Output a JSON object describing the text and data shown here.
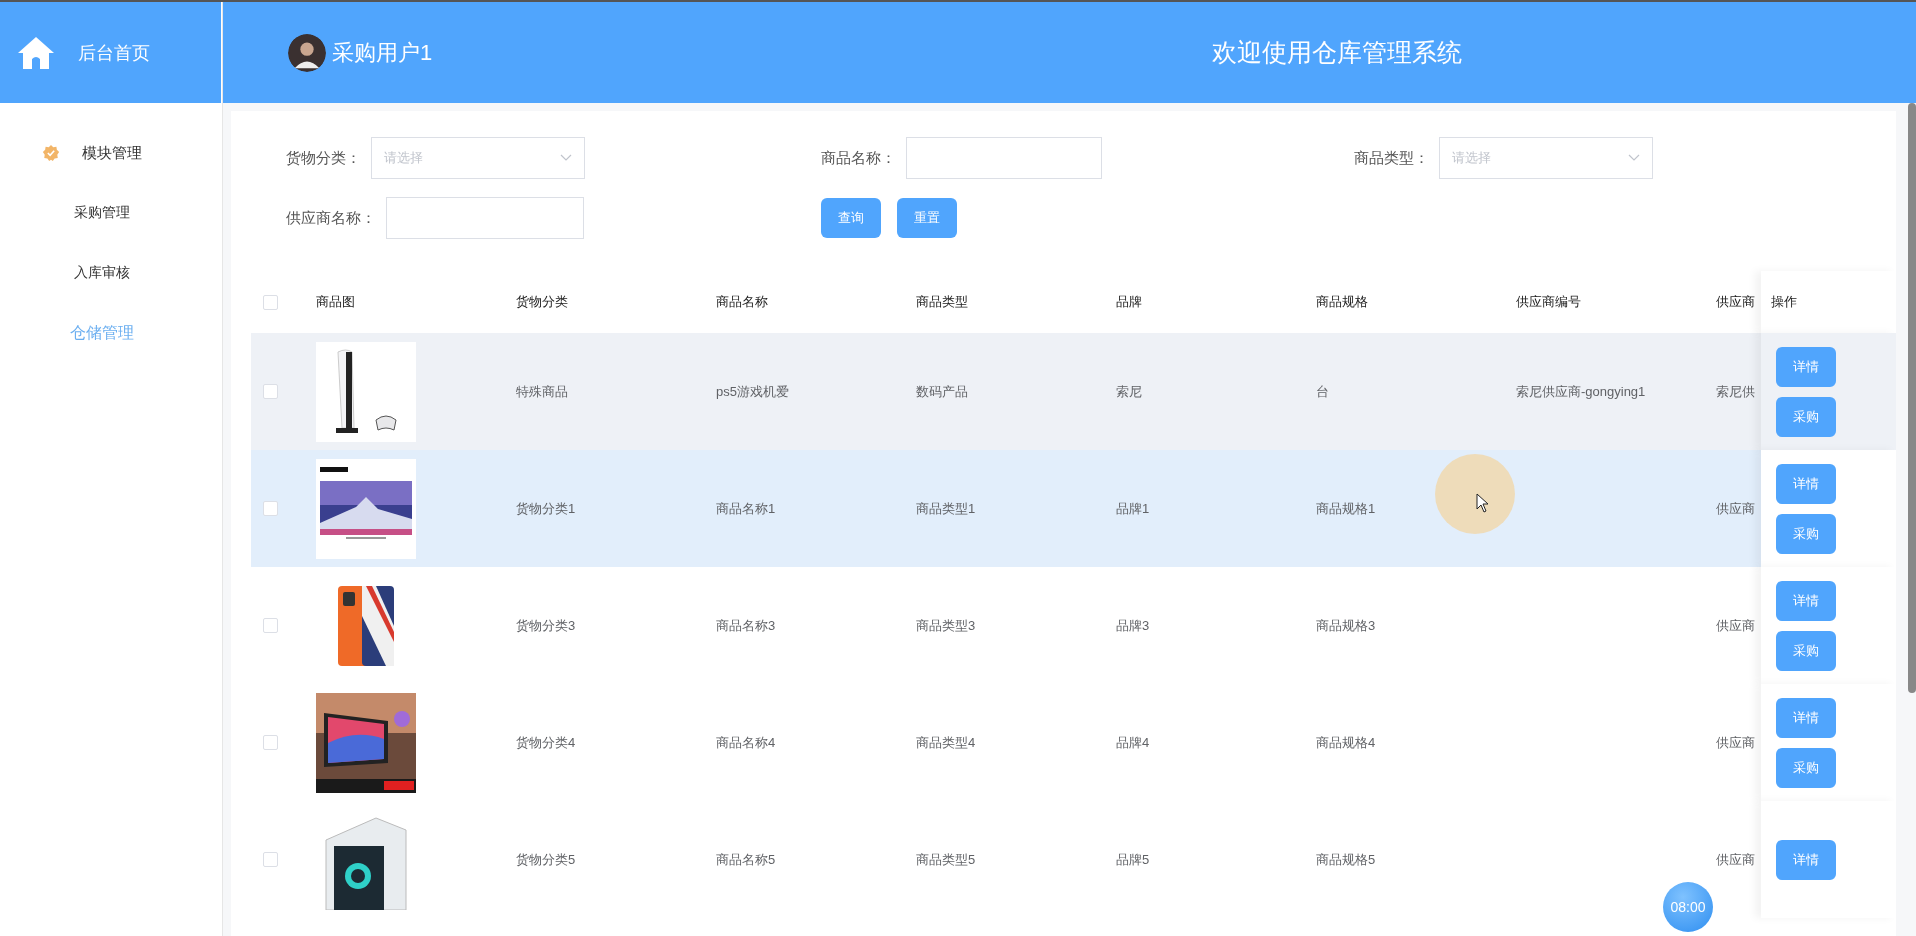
{
  "sidebar": {
    "home": "后台首页",
    "items": [
      {
        "label": "模块管理",
        "kind": "group",
        "selected": false
      },
      {
        "label": "采购管理",
        "kind": "item",
        "selected": false
      },
      {
        "label": "入库审核",
        "kind": "item",
        "selected": false
      },
      {
        "label": "仓储管理",
        "kind": "item",
        "selected": true
      }
    ]
  },
  "header": {
    "user": "采购用户1",
    "welcome": "欢迎使用仓库管理系统"
  },
  "filters": [
    {
      "label": "货物分类：",
      "kind": "select",
      "placeholder": "请选择"
    },
    {
      "label": "商品名称：",
      "kind": "input"
    },
    {
      "label": "商品类型：",
      "kind": "select",
      "placeholder": "请选择"
    },
    {
      "label": "供应商名称：",
      "kind": "input"
    }
  ],
  "filter_buttons": [
    "查询",
    "重置"
  ],
  "table": {
    "select_all_checked": false,
    "columns": [
      "商品图",
      "货物分类",
      "商品名称",
      "商品类型",
      "品牌",
      "商品规格",
      "供应商编号",
      "供应商",
      "操作"
    ],
    "rows": [
      {
        "checked": false,
        "current": true,
        "hovered": false,
        "category": "特殊商品",
        "name": "ps5游戏机爱",
        "type": "数码产品",
        "brand": "索尼",
        "spec": "台",
        "supplier_code": "索尼供应商-gongying1",
        "supplier": "索尼供",
        "actions": [
          "详情",
          "采购"
        ]
      },
      {
        "checked": false,
        "current": false,
        "hovered": true,
        "category": "货物分类1",
        "name": "商品名称1",
        "type": "商品类型1",
        "brand": "品牌1",
        "spec": "商品规格1",
        "supplier": "供应商",
        "actions": [
          "详情",
          "采购"
        ]
      },
      {
        "checked": false,
        "current": false,
        "hovered": false,
        "category": "货物分类3",
        "name": "商品名称3",
        "type": "商品类型3",
        "brand": "品牌3",
        "spec": "商品规格3",
        "supplier": "供应商",
        "actions": [
          "详情",
          "采购"
        ]
      },
      {
        "checked": false,
        "current": false,
        "hovered": false,
        "category": "货物分类4",
        "name": "商品名称4",
        "type": "商品类型4",
        "brand": "品牌4",
        "spec": "商品规格4",
        "supplier": "供应商",
        "actions": [
          "详情",
          "采购"
        ]
      },
      {
        "checked": false,
        "current": false,
        "hovered": false,
        "category": "货物分类5",
        "name": "商品名称5",
        "type": "商品类型5",
        "brand": "品牌5",
        "spec": "商品规格5",
        "supplier": "供应商",
        "actions": [
          "详情"
        ]
      }
    ]
  },
  "timer": "08:00"
}
